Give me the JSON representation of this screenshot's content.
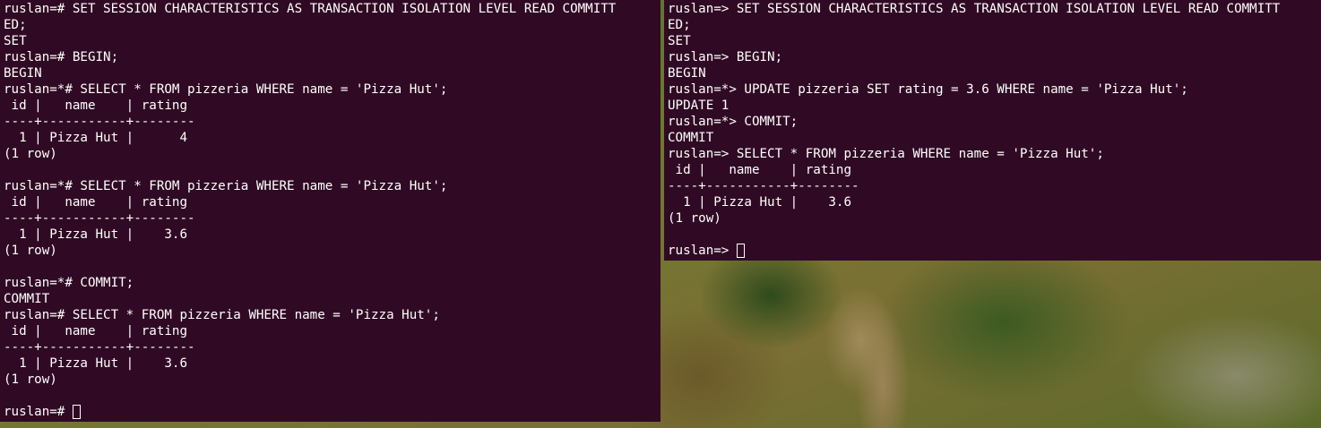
{
  "left_terminal": {
    "lines": [
      "ruslan=# SET SESSION CHARACTERISTICS AS TRANSACTION ISOLATION LEVEL READ COMMITT",
      "ED;",
      "SET",
      "ruslan=# BEGIN;",
      "BEGIN",
      "ruslan=*# SELECT * FROM pizzeria WHERE name = 'Pizza Hut';",
      " id |   name    | rating",
      "----+-----------+--------",
      "  1 | Pizza Hut |      4",
      "(1 row)",
      "",
      "ruslan=*# SELECT * FROM pizzeria WHERE name = 'Pizza Hut';",
      " id |   name    | rating",
      "----+-----------+--------",
      "  1 | Pizza Hut |    3.6",
      "(1 row)",
      "",
      "ruslan=*# COMMIT;",
      "COMMIT",
      "ruslan=# SELECT * FROM pizzeria WHERE name = 'Pizza Hut';",
      " id |   name    | rating",
      "----+-----------+--------",
      "  1 | Pizza Hut |    3.6",
      "(1 row)",
      ""
    ],
    "prompt": "ruslan=# "
  },
  "right_terminal": {
    "lines": [
      "ruslan=> SET SESSION CHARACTERISTICS AS TRANSACTION ISOLATION LEVEL READ COMMITT",
      "ED;",
      "SET",
      "ruslan=> BEGIN;",
      "BEGIN",
      "ruslan=*> UPDATE pizzeria SET rating = 3.6 WHERE name = 'Pizza Hut';",
      "UPDATE 1",
      "ruslan=*> COMMIT;",
      "COMMIT",
      "ruslan=> SELECT * FROM pizzeria WHERE name = 'Pizza Hut';",
      " id |   name    | rating",
      "----+-----------+--------",
      "  1 | Pizza Hut |    3.6",
      "(1 row)",
      ""
    ],
    "prompt": "ruslan=> "
  },
  "colors": {
    "terminal_bg": "#300a24",
    "terminal_fg": "#ffffff"
  }
}
